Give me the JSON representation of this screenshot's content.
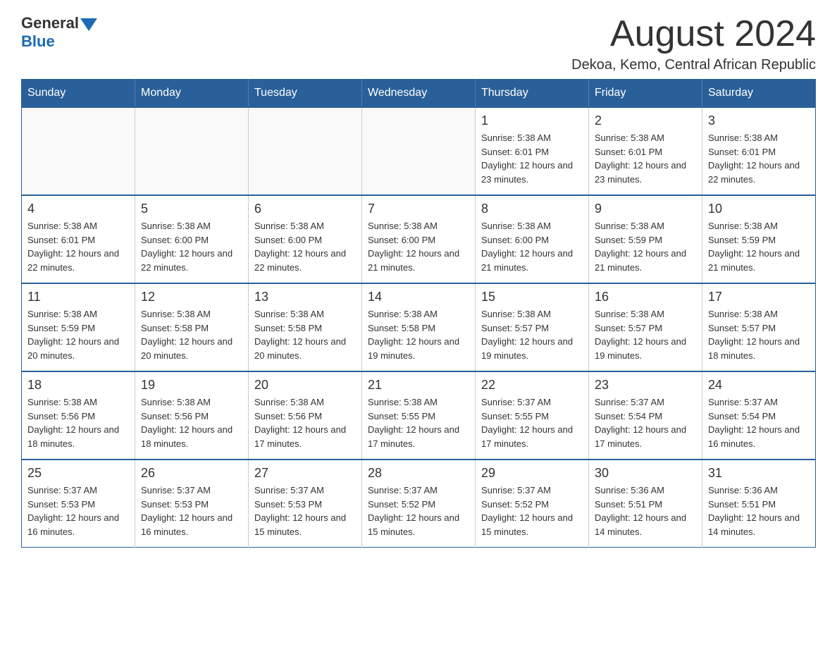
{
  "header": {
    "logo_general": "General",
    "logo_blue": "Blue",
    "month_title": "August 2024",
    "location": "Dekoa, Kemo, Central African Republic"
  },
  "calendar": {
    "days_of_week": [
      "Sunday",
      "Monday",
      "Tuesday",
      "Wednesday",
      "Thursday",
      "Friday",
      "Saturday"
    ],
    "weeks": [
      [
        {
          "day": "",
          "info": ""
        },
        {
          "day": "",
          "info": ""
        },
        {
          "day": "",
          "info": ""
        },
        {
          "day": "",
          "info": ""
        },
        {
          "day": "1",
          "info": "Sunrise: 5:38 AM\nSunset: 6:01 PM\nDaylight: 12 hours and 23 minutes."
        },
        {
          "day": "2",
          "info": "Sunrise: 5:38 AM\nSunset: 6:01 PM\nDaylight: 12 hours and 23 minutes."
        },
        {
          "day": "3",
          "info": "Sunrise: 5:38 AM\nSunset: 6:01 PM\nDaylight: 12 hours and 22 minutes."
        }
      ],
      [
        {
          "day": "4",
          "info": "Sunrise: 5:38 AM\nSunset: 6:01 PM\nDaylight: 12 hours and 22 minutes."
        },
        {
          "day": "5",
          "info": "Sunrise: 5:38 AM\nSunset: 6:00 PM\nDaylight: 12 hours and 22 minutes."
        },
        {
          "day": "6",
          "info": "Sunrise: 5:38 AM\nSunset: 6:00 PM\nDaylight: 12 hours and 22 minutes."
        },
        {
          "day": "7",
          "info": "Sunrise: 5:38 AM\nSunset: 6:00 PM\nDaylight: 12 hours and 21 minutes."
        },
        {
          "day": "8",
          "info": "Sunrise: 5:38 AM\nSunset: 6:00 PM\nDaylight: 12 hours and 21 minutes."
        },
        {
          "day": "9",
          "info": "Sunrise: 5:38 AM\nSunset: 5:59 PM\nDaylight: 12 hours and 21 minutes."
        },
        {
          "day": "10",
          "info": "Sunrise: 5:38 AM\nSunset: 5:59 PM\nDaylight: 12 hours and 21 minutes."
        }
      ],
      [
        {
          "day": "11",
          "info": "Sunrise: 5:38 AM\nSunset: 5:59 PM\nDaylight: 12 hours and 20 minutes."
        },
        {
          "day": "12",
          "info": "Sunrise: 5:38 AM\nSunset: 5:58 PM\nDaylight: 12 hours and 20 minutes."
        },
        {
          "day": "13",
          "info": "Sunrise: 5:38 AM\nSunset: 5:58 PM\nDaylight: 12 hours and 20 minutes."
        },
        {
          "day": "14",
          "info": "Sunrise: 5:38 AM\nSunset: 5:58 PM\nDaylight: 12 hours and 19 minutes."
        },
        {
          "day": "15",
          "info": "Sunrise: 5:38 AM\nSunset: 5:57 PM\nDaylight: 12 hours and 19 minutes."
        },
        {
          "day": "16",
          "info": "Sunrise: 5:38 AM\nSunset: 5:57 PM\nDaylight: 12 hours and 19 minutes."
        },
        {
          "day": "17",
          "info": "Sunrise: 5:38 AM\nSunset: 5:57 PM\nDaylight: 12 hours and 18 minutes."
        }
      ],
      [
        {
          "day": "18",
          "info": "Sunrise: 5:38 AM\nSunset: 5:56 PM\nDaylight: 12 hours and 18 minutes."
        },
        {
          "day": "19",
          "info": "Sunrise: 5:38 AM\nSunset: 5:56 PM\nDaylight: 12 hours and 18 minutes."
        },
        {
          "day": "20",
          "info": "Sunrise: 5:38 AM\nSunset: 5:56 PM\nDaylight: 12 hours and 17 minutes."
        },
        {
          "day": "21",
          "info": "Sunrise: 5:38 AM\nSunset: 5:55 PM\nDaylight: 12 hours and 17 minutes."
        },
        {
          "day": "22",
          "info": "Sunrise: 5:37 AM\nSunset: 5:55 PM\nDaylight: 12 hours and 17 minutes."
        },
        {
          "day": "23",
          "info": "Sunrise: 5:37 AM\nSunset: 5:54 PM\nDaylight: 12 hours and 17 minutes."
        },
        {
          "day": "24",
          "info": "Sunrise: 5:37 AM\nSunset: 5:54 PM\nDaylight: 12 hours and 16 minutes."
        }
      ],
      [
        {
          "day": "25",
          "info": "Sunrise: 5:37 AM\nSunset: 5:53 PM\nDaylight: 12 hours and 16 minutes."
        },
        {
          "day": "26",
          "info": "Sunrise: 5:37 AM\nSunset: 5:53 PM\nDaylight: 12 hours and 16 minutes."
        },
        {
          "day": "27",
          "info": "Sunrise: 5:37 AM\nSunset: 5:53 PM\nDaylight: 12 hours and 15 minutes."
        },
        {
          "day": "28",
          "info": "Sunrise: 5:37 AM\nSunset: 5:52 PM\nDaylight: 12 hours and 15 minutes."
        },
        {
          "day": "29",
          "info": "Sunrise: 5:37 AM\nSunset: 5:52 PM\nDaylight: 12 hours and 15 minutes."
        },
        {
          "day": "30",
          "info": "Sunrise: 5:36 AM\nSunset: 5:51 PM\nDaylight: 12 hours and 14 minutes."
        },
        {
          "day": "31",
          "info": "Sunrise: 5:36 AM\nSunset: 5:51 PM\nDaylight: 12 hours and 14 minutes."
        }
      ]
    ]
  }
}
